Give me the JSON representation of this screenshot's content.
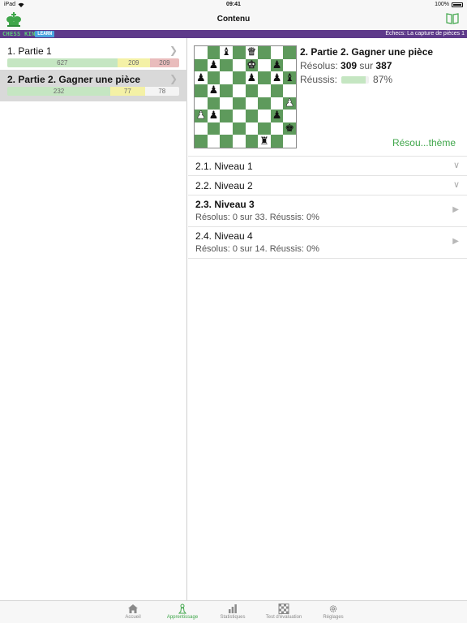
{
  "status": {
    "device": "iPad",
    "time": "09:41",
    "battery": "100%"
  },
  "nav": {
    "title": "Contenu",
    "logo_icon": "chess-king-logo-icon",
    "book_icon": "book-icon"
  },
  "brand": {
    "name": "CHESS KING",
    "badge": "LEARN",
    "subtitle": "Échecs: La capture de pièces 1"
  },
  "parts": [
    {
      "name": "1. Partie 1",
      "selected": false,
      "progress": [
        {
          "value": "627",
          "fraction": 0.64,
          "kind": "green"
        },
        {
          "value": "209",
          "fraction": 0.19,
          "kind": "yellow"
        },
        {
          "value": "209",
          "fraction": 0.17,
          "kind": "red"
        }
      ]
    },
    {
      "name": "2. Partie 2. Gagner une pièce",
      "selected": true,
      "progress": [
        {
          "value": "232",
          "fraction": 0.6,
          "kind": "green"
        },
        {
          "value": "77",
          "fraction": 0.2,
          "kind": "yellow"
        },
        {
          "value": "78",
          "fraction": 0.2,
          "kind": "white"
        }
      ]
    }
  ],
  "topic": {
    "title": "2. Partie 2. Gagner une pièce",
    "solved_label": "Résolus:",
    "solved": "309",
    "solved_of": "sur",
    "total": "387",
    "success_label": "Réussis:",
    "success_pct": "87%",
    "success_fraction": 0.87,
    "solve_link": "Résou...thème"
  },
  "board": {
    "colors": {
      "light": "#ffffff",
      "dark": "#5e9a5c"
    },
    "rows": [
      [
        "",
        "",
        "bB",
        "",
        "wQ",
        "",
        "",
        ""
      ],
      [
        "",
        "bP",
        "",
        "",
        "wK",
        "",
        "bP",
        ""
      ],
      [
        "bP",
        "",
        "",
        "",
        "bP",
        "",
        "bP",
        "bB"
      ],
      [
        "",
        "bP",
        "",
        "",
        "",
        "",
        "",
        ""
      ],
      [
        "",
        "",
        "",
        "",
        "",
        "",
        "",
        "wP"
      ],
      [
        "wP",
        "bP",
        "",
        "",
        "",
        "",
        "bP",
        ""
      ],
      [
        "",
        "",
        "",
        "",
        "",
        "",
        "",
        "bK"
      ],
      [
        "",
        "",
        "",
        "",
        "",
        "bR",
        "",
        ""
      ]
    ]
  },
  "levels": [
    {
      "name": "2.1. Niveau 1",
      "stat": "",
      "bold": false,
      "indicator": "chevron-down-icon"
    },
    {
      "name": "2.2. Niveau 2",
      "stat": "",
      "bold": false,
      "indicator": "chevron-down-icon"
    },
    {
      "name": "2.3. Niveau 3",
      "stat": "Résolus: 0 sur 33. Réussis: 0%",
      "bold": true,
      "indicator": "play-icon"
    },
    {
      "name": "2.4. Niveau 4",
      "stat": "Résolus: 0 sur 14. Réussis: 0%",
      "bold": false,
      "indicator": "play-icon"
    }
  ],
  "tabs": [
    {
      "label": "Accueil",
      "icon": "home-icon",
      "active": false
    },
    {
      "label": "Apprentissage",
      "icon": "pawn-icon",
      "active": true
    },
    {
      "label": "Statistiques",
      "icon": "bar-chart-icon",
      "active": false
    },
    {
      "label": "Test d'évaluation",
      "icon": "checkerboard-icon",
      "active": false
    },
    {
      "label": "Réglages",
      "icon": "gear-icon",
      "active": false
    }
  ],
  "colors": {
    "accent": "#3fa64a",
    "brand_bar": "#5e3a8a"
  }
}
